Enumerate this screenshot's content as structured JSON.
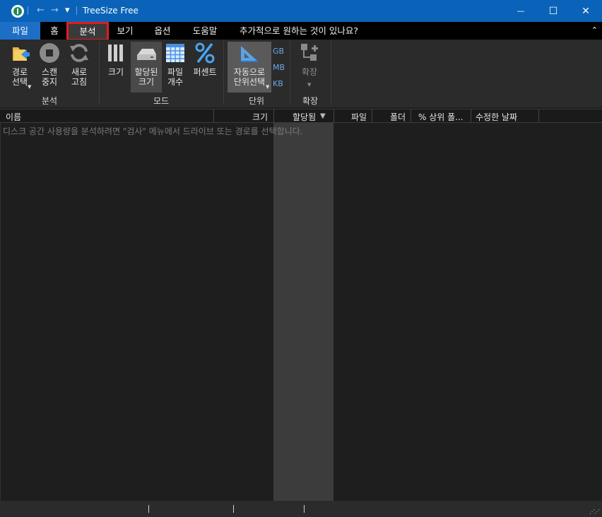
{
  "window": {
    "title": "TreeSize Free",
    "back_glyph": "←",
    "forward_glyph": "→",
    "dropdown_glyph": "▾",
    "minimize_glyph": "—",
    "maximize_glyph": "☐",
    "close_glyph": "✕"
  },
  "menu": {
    "items": [
      {
        "label": "파일"
      },
      {
        "label": "홈"
      },
      {
        "label": "분석"
      },
      {
        "label": "보기"
      },
      {
        "label": "옵션"
      },
      {
        "label": "도움말"
      },
      {
        "label": "추가적으로 원하는 것이 있나요?"
      }
    ],
    "collapse_glyph": "⌃",
    "accent": "#1d6fc6",
    "highlight_color": "#e01e1e"
  },
  "ribbon": {
    "analysis": {
      "select_path": "경로\n선택",
      "stop_scan": "스캔\n중지",
      "refresh": "새로\n고침",
      "group": "분석"
    },
    "mode": {
      "size": "크기",
      "allocated_size": "할당된\n크기",
      "file_count": "파일\n개수",
      "percent": "퍼센트",
      "group": "모드"
    },
    "unit": {
      "auto_select": "자동으로\n단위선택",
      "gb": "GB",
      "mb": "MB",
      "kb": "KB",
      "group": "단위"
    },
    "expand": {
      "expand": "확장",
      "group": "확장"
    }
  },
  "columns": {
    "name": "이름",
    "size": "크기",
    "allocated": "할당됨",
    "files": "파일",
    "folders": "폴더",
    "percent_parent": "% 상위 폴...",
    "modified": "수정한 날짜"
  },
  "content": {
    "hint": "디스크 공간 사용량을 분석하려면 \"검사\" 메뉴에서 드라이브 또는 경로를 선택합니다."
  },
  "colors": {
    "titlebar": "#0a63b8",
    "unit_blue": "#6ea6e8"
  }
}
